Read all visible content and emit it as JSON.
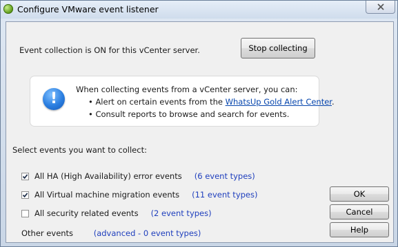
{
  "window": {
    "title": "Configure VMware event listener",
    "close_icon": "close-icon",
    "app_icon": "vmware-listener-icon"
  },
  "status": {
    "text": "Event collection is ON for this vCenter server.",
    "stop_button": "Stop collecting"
  },
  "info": {
    "icon": "info-icon",
    "heading": "When collecting events from a vCenter server, you can:",
    "bullet1_prefix": "• Alert on certain events from the ",
    "bullet1_link": "WhatsUp Gold Alert Center",
    "bullet1_suffix": ".",
    "bullet2": "• Consult reports to browse and search for events."
  },
  "events": {
    "section_label": "Select events you want to collect:",
    "items": [
      {
        "label": "All HA (High Availability) error events",
        "types": "(6 event types)",
        "checked": true
      },
      {
        "label": "All Virtual machine migration events",
        "types": "(11 event types)",
        "checked": true
      },
      {
        "label": "All security related events",
        "types": "(2 event types)",
        "checked": false
      }
    ],
    "other_label": "Other events",
    "other_types": "(advanced - 0 event types)"
  },
  "buttons": {
    "ok": "OK",
    "cancel": "Cancel",
    "help": "Help"
  }
}
